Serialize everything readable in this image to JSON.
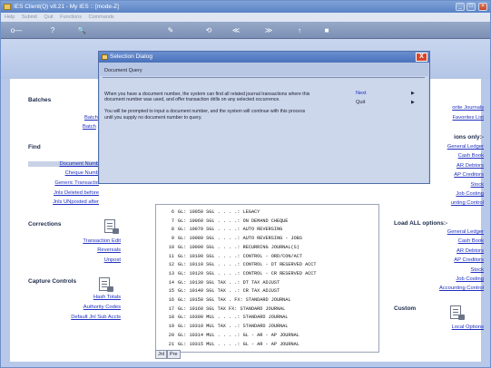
{
  "window": {
    "title": "IES Client(Q) v8.21 - My IES :: [mode-Z]"
  },
  "menu": [
    "Help",
    "Submit",
    "Quit",
    "Functions",
    "Commands"
  ],
  "toolbar": {
    "items": [
      "o—",
      "?",
      "🔍",
      "✎",
      "⟲",
      "≪",
      "≫",
      "↑",
      "■"
    ]
  },
  "left": {
    "batches": "Batches",
    "batch_link1": "Batch",
    "batch_link2": "Batch",
    "find": "Find",
    "find_links": [
      "Document Numb",
      "Cheque Numb",
      "Generic Transactio",
      "Jnls Deleted before",
      "Jnls UNposted after"
    ],
    "corrections": "Corrections",
    "correction_links": [
      "Transaction Edit",
      "Reversals",
      "Unpost"
    ],
    "capture": "Capture Controls",
    "capture_links": [
      "Hash Totals",
      "Authority Codes",
      "Default Jnl Sub Accts"
    ]
  },
  "right": {
    "links_top": [
      "orite Journals",
      "Favorites List"
    ],
    "only_title": "ions only:-",
    "only_links": [
      "General Ledger",
      "Cash Book",
      "AR Debtors",
      "AP Creditors",
      "Stock",
      "Job Costing",
      "unting Control"
    ],
    "loadall": "Load ALL options:-",
    "loadall_links": [
      "General Ledger",
      "Cash Book",
      "AR Debtors",
      "AP Creditors",
      "Stock",
      "Job Costing",
      "Accounting Control"
    ],
    "custom": "Custom",
    "custom_links": [
      "Local Options"
    ]
  },
  "journal": {
    "rows": [
      {
        "n": "6",
        "t": "GL: 10050 SGL . . . .: LEGACY"
      },
      {
        "n": "7",
        "t": "GL: 10060 SGL . . . .: ON DEMAND CHEQUE"
      },
      {
        "n": "8",
        "t": "GL: 10070 SGL . . . .: AUTO REVERSING"
      },
      {
        "n": "9",
        "t": "GL: 10080 SGL . . . .: AUTO REVERSING - JOBS"
      },
      {
        "n": "10",
        "t": "GL: 10090 SGL . . . .: RECURRING JOURNAL(S)"
      },
      {
        "n": "11",
        "t": "GL: 10100 SGL . . . .: CONTROL - ORD/CON/ACT"
      },
      {
        "n": "12",
        "t": "GL: 10110 SGL . . . .: CONTROL - DT RESERVED ACCT"
      },
      {
        "n": "13",
        "t": "GL: 10120 SGL . . . .: CONTROL - CR RESERVED ACCT"
      },
      {
        "n": "14",
        "t": "GL: 10130 SGL TAX . .: DT TAX ADJUST"
      },
      {
        "n": "15",
        "t": "GL: 10140 SGL TAX . .: CR TAX ADJUST"
      },
      {
        "n": "16",
        "t": "GL: 10150 SGL TAX . FX: STANDARD JOURNAL"
      },
      {
        "n": "17",
        "t": "GL: 10160 SGL TAX FX: STANDARD JOURNAL"
      },
      {
        "n": "18",
        "t": "GL: 10300 MUL . . . .: STANDARD JOURNAL"
      },
      {
        "n": "19",
        "t": "GL: 10310 MUL TAX . .: STANDARD JOURNAL"
      },
      {
        "n": "20",
        "t": "GL: 10314 MUL . . . .: GL - AR - AP JOURNAL"
      },
      {
        "n": "21",
        "t": "GL: 10315 MUL . . . .: GL - AR - AP JOURNAL"
      }
    ],
    "tabs": [
      "Jnl",
      "Pre"
    ]
  },
  "dialog": {
    "title": "Selection Dialog",
    "subtitle": "Document Query",
    "para1a": "When you have a document number, the system can find all related journal transactions where this",
    "para1b": "document number was used, and offer transaction drills on any selected occurrence.",
    "para2a": "You will be prompted to input a document number, and the system will continue with this process",
    "para2b": "until you supply no document number to query.",
    "next": "Next",
    "quit": "Quit",
    "close": "X"
  },
  "colors": {
    "accent": "#4a72bb",
    "link": "#1f2fbf",
    "close": "#d8462a"
  }
}
